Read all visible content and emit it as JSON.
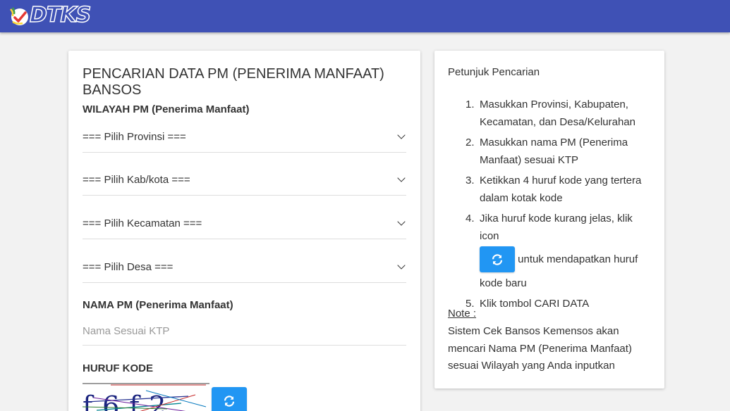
{
  "header": {
    "logo_text": "DTKS",
    "brand_color": "#3f51b5"
  },
  "form": {
    "title": "PENCARIAN DATA PM (PENERIMA MANFAAT) BANSOS",
    "wilayah_label": "WILAYAH PM (Penerima Manfaat)",
    "provinsi_selected": "=== Pilih Provinsi ===",
    "kabkota_selected": "=== Pilih Kab/kota ===",
    "kecamatan_selected": "=== Pilih Kecamatan ===",
    "desa_selected": "=== Pilih Desa ===",
    "nama_label": "NAMA PM (Penerima Manfaat)",
    "nama_value": "",
    "nama_placeholder": "Nama Sesuai KTP",
    "kode_label": "HURUF KODE",
    "captcha_text": "f6f2",
    "refresh_icon": "refresh-icon",
    "button_color": "#2196f3"
  },
  "help": {
    "title": "Petunjuk Pencarian",
    "steps": [
      {
        "num": "1.",
        "text": "Masukkan Provinsi, Kabupaten, Kecamatan, dan Desa/Kelurahan"
      },
      {
        "num": "2.",
        "text": "Masukkan nama PM (Penerima Manfaat) sesuai KTP"
      },
      {
        "num": "3.",
        "text": "Ketikkan 4 huruf kode yang tertera dalam kotak kode"
      },
      {
        "num": "4.",
        "text_before": "Jika huruf kode kurang jelas, klik icon",
        "text_after": "untuk mendapatkan huruf kode baru"
      },
      {
        "num": "5.",
        "text": "Klik tombol CARI DATA"
      }
    ],
    "note_label": "Note :",
    "note_text": "Sistem Cek Bansos Kemensos akan mencari Nama PM (Penerima Manfaat) sesuai Wilayah yang Anda inputkan"
  }
}
